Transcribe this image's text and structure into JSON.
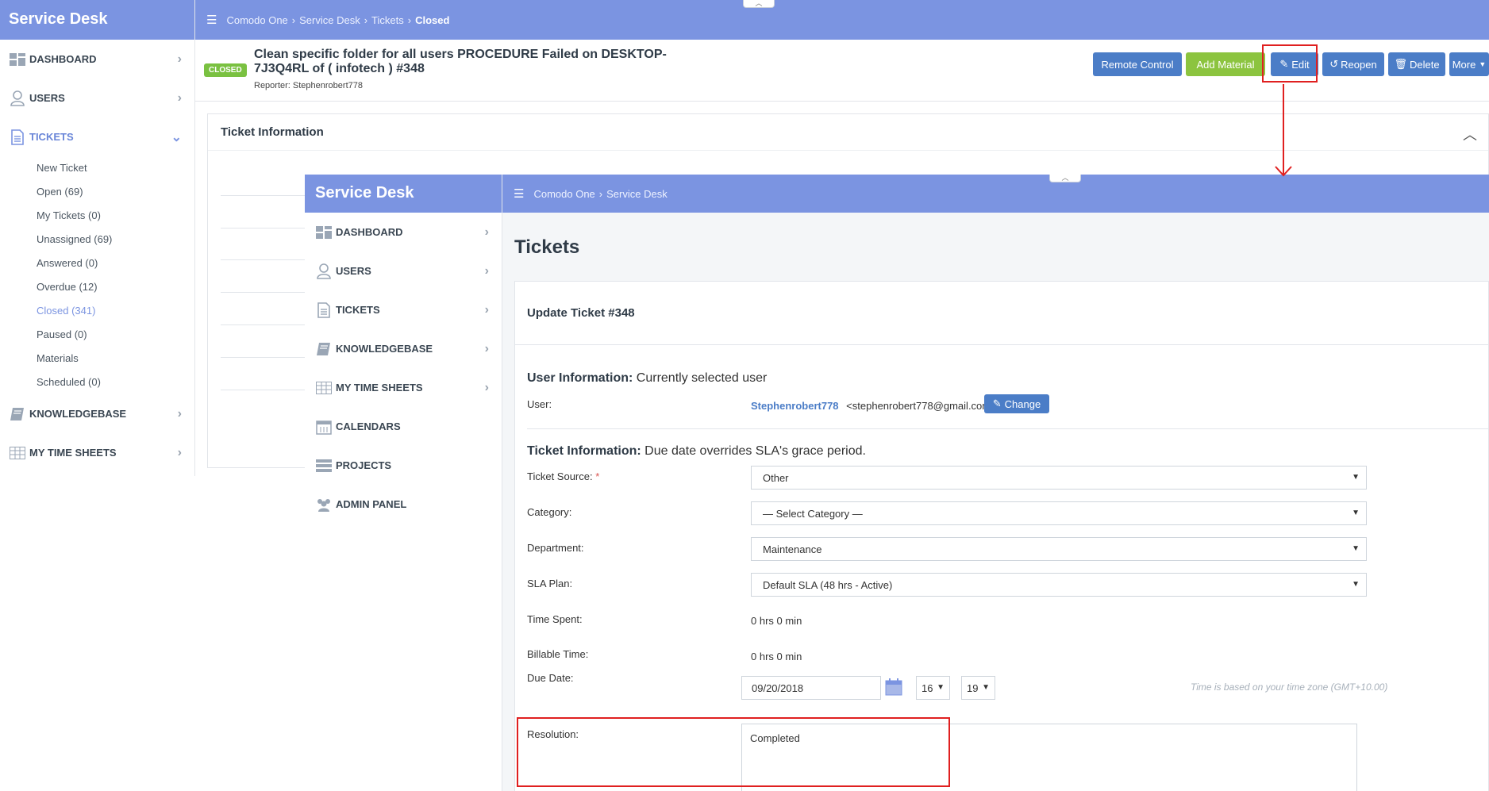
{
  "app": {
    "title": "Service Desk"
  },
  "back": {
    "breadcrumb": [
      "Comodo One",
      "Service Desk",
      "Tickets",
      "Closed"
    ],
    "nav": [
      {
        "label": "DASHBOARD",
        "icon": "dashboard-icon"
      },
      {
        "label": "USERS",
        "icon": "user-icon"
      },
      {
        "label": "TICKETS",
        "icon": "document-icon"
      },
      {
        "label": "KNOWLEDGEBASE",
        "icon": "book-icon"
      },
      {
        "label": "MY TIME SHEETS",
        "icon": "table-icon"
      }
    ],
    "ticket_submenu": [
      "New Ticket",
      "Open (69)",
      "My Tickets (0)",
      "Unassigned (69)",
      "Answered (0)",
      "Overdue (12)",
      "Closed (341)",
      "Paused (0)",
      "Materials",
      "Scheduled (0)"
    ],
    "active_submenu_index": 6,
    "ticket": {
      "status": "CLOSED",
      "title": "Clean specific folder for all users PROCEDURE Failed on DESKTOP-7J3Q4RL of ( infotech ) #348",
      "reporter": "Reporter: Stephenrobert778"
    },
    "actions": {
      "remote_control": "Remote Control",
      "add_material": "Add Material",
      "edit": "Edit",
      "reopen": "Reopen",
      "delete": "Delete",
      "more": "More"
    },
    "panel_title": "Ticket Information"
  },
  "front": {
    "breadcrumb": [
      "Comodo One",
      "Service Desk"
    ],
    "nav": [
      {
        "label": "DASHBOARD",
        "icon": "dashboard-icon"
      },
      {
        "label": "USERS",
        "icon": "user-icon"
      },
      {
        "label": "TICKETS",
        "icon": "document-icon"
      },
      {
        "label": "KNOWLEDGEBASE",
        "icon": "book-icon"
      },
      {
        "label": "MY TIME SHEETS",
        "icon": "table-icon"
      },
      {
        "label": "CALENDARS",
        "icon": "calendar-icon"
      },
      {
        "label": "PROJECTS",
        "icon": "projects-icon"
      },
      {
        "label": "ADMIN PANEL",
        "icon": "users-group-icon"
      }
    ],
    "page_title": "Tickets",
    "card_title": "Update Ticket #348",
    "user_info": {
      "heading": "User Information:",
      "subheading": "Currently selected user",
      "user_label": "User:",
      "user_name": "Stephenrobert778",
      "user_email": "<stephenrobert778@gmail.com>",
      "change_label": "Change"
    },
    "ticket_info": {
      "heading": "Ticket Information:",
      "subheading": "Due date overrides SLA's grace period.",
      "source_label": "Ticket Source:",
      "source_value": "Other",
      "category_label": "Category:",
      "category_value": "— Select Category —",
      "department_label": "Department:",
      "department_value": "Maintenance",
      "sla_label": "SLA Plan:",
      "sla_value": "Default SLA (48 hrs - Active)",
      "time_spent_label": "Time Spent:",
      "time_spent_value": "0 hrs 0 min",
      "billable_label": "Billable Time:",
      "billable_value": "0 hrs 0 min",
      "due_label": "Due Date:",
      "due_date": "09/20/2018",
      "due_hour": "16",
      "due_minute": "19",
      "tz_note": "Time is based on your time zone (GMT+10.00)",
      "resolution_label": "Resolution:",
      "resolution_value": "Completed"
    }
  },
  "colors": {
    "brand": "#7b94e1",
    "primary_button": "#4b7dc7",
    "success_button": "#8cc43f",
    "annotation": "#e02020"
  }
}
